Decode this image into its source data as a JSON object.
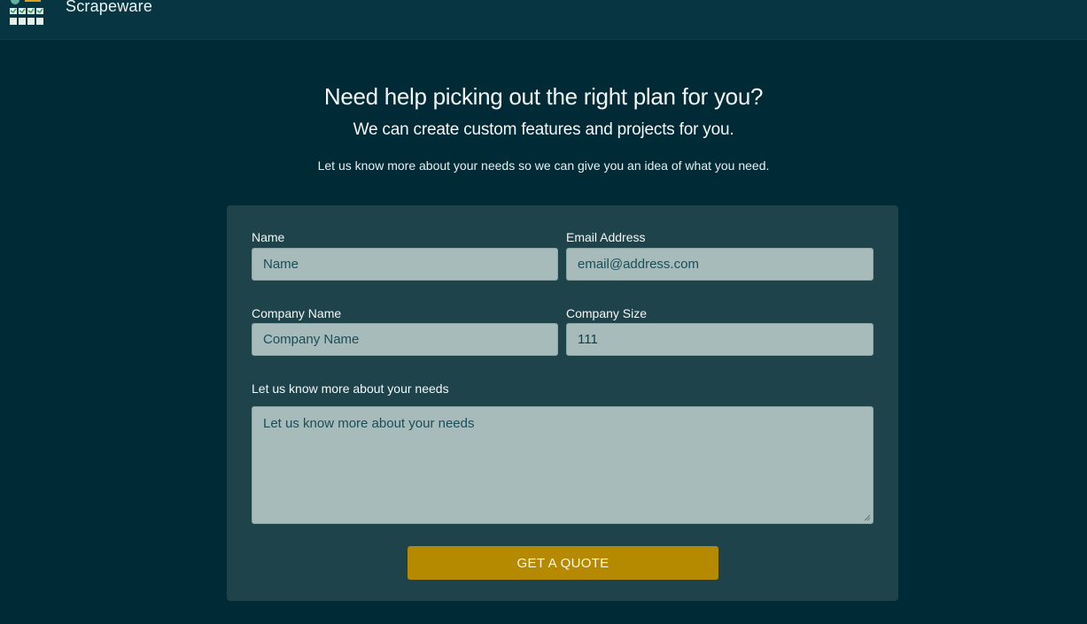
{
  "navbar": {
    "brand": "Scrapeware",
    "logo_icon": "scrapeware-logo-icon"
  },
  "hero": {
    "heading": "Need help picking out the right plan for you?",
    "subheading": "We can create custom features and projects for you.",
    "lead": "Let us know more about your needs so we can give you an idea of what you need."
  },
  "form": {
    "name": {
      "label": "Name",
      "placeholder": "Name",
      "value": ""
    },
    "email": {
      "label": "Email Address",
      "placeholder": "email@address.com",
      "value": ""
    },
    "company_name": {
      "label": "Company Name",
      "placeholder": "Company Name",
      "value": ""
    },
    "company_size": {
      "label": "Company Size",
      "placeholder": "",
      "value": "111"
    },
    "needs": {
      "label": "Let us know more about your needs",
      "placeholder": "Let us know more about your needs",
      "value": ""
    },
    "submit_label": "GET A QUOTE"
  },
  "colors": {
    "background": "#002b36",
    "navbar": "#073642",
    "card": "#1f434b",
    "input": "#a6bbba",
    "accent": "#b58900"
  }
}
